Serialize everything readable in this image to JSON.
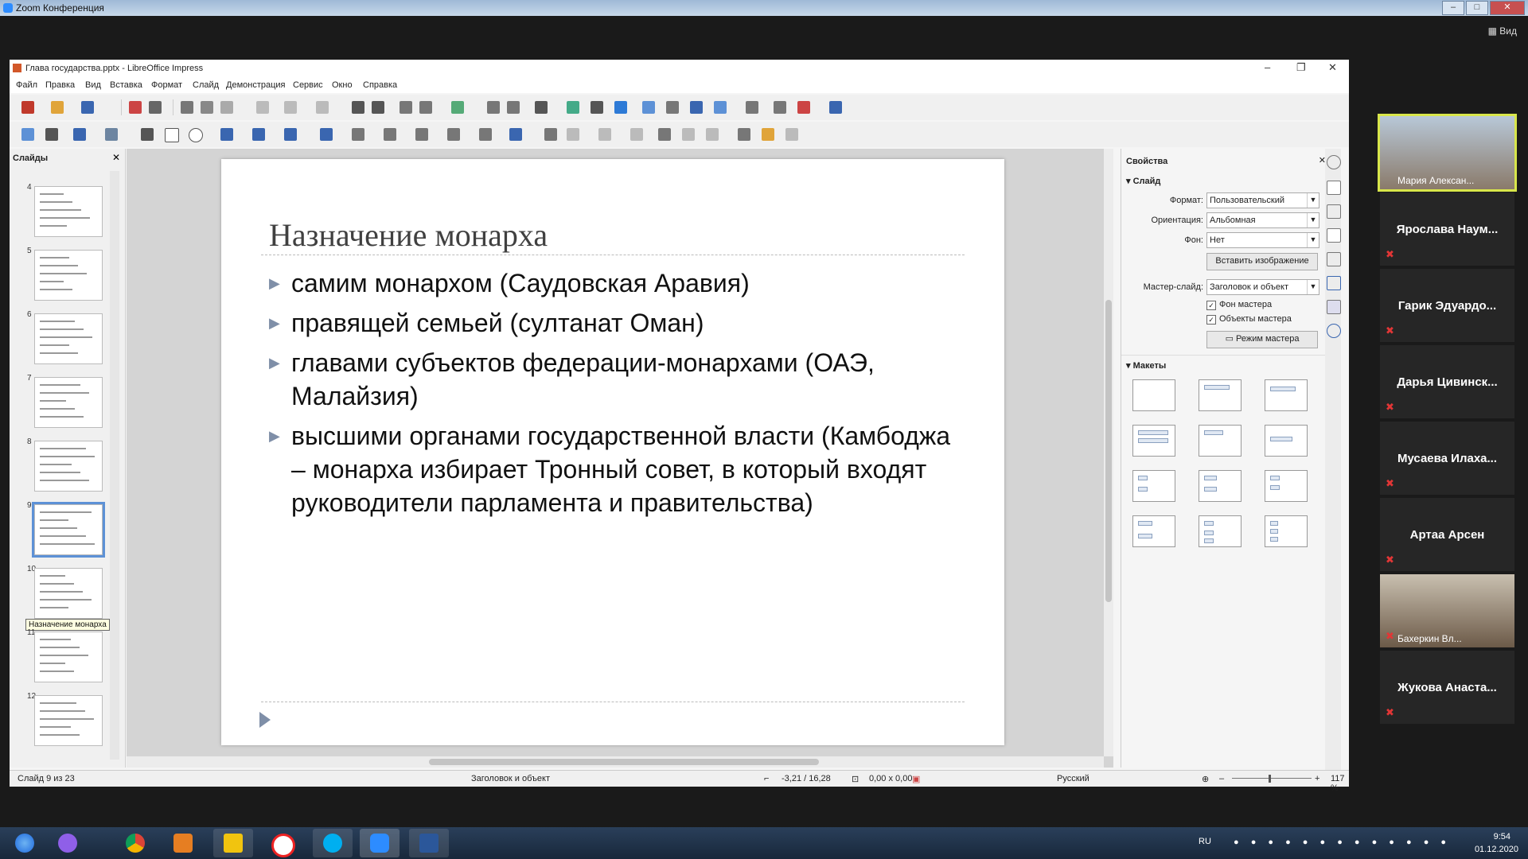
{
  "zoom": {
    "title": "Zoom Конференция",
    "view_label": "Вид"
  },
  "window": {
    "title": "Глава государства.pptx - LibreOffice Impress"
  },
  "menu": [
    "Файл",
    "Правка",
    "Вид",
    "Вставка",
    "Формат",
    "Слайд",
    "Демонстрация",
    "Сервис",
    "Окно",
    "Справка"
  ],
  "slides_panel": {
    "header": "Слайды",
    "numbers": [
      "4",
      "5",
      "6",
      "7",
      "8",
      "9",
      "10",
      "11",
      "12"
    ],
    "selected_index": 5,
    "tooltip": "Назначение монарха"
  },
  "slide": {
    "title": "Назначение монарха",
    "bullets": [
      "самим монархом (Саудовская Аравия)",
      "правящей семьей (султанат Оман)",
      "главами субъектов федерации-монархами (ОАЭ, Малайзия)",
      "высшими органами государственной власти (Камбоджа – монарха избирает Тронный совет, в который входят руководители парламента и правительства)"
    ]
  },
  "properties": {
    "header": "Свойства",
    "section_slide": "Слайд",
    "format_label": "Формат:",
    "format_value": "Пользовательский",
    "orientation_label": "Ориентация:",
    "orientation_value": "Альбомная",
    "background_label": "Фон:",
    "background_value": "Нет",
    "insert_image_button": "Вставить изображение",
    "master_label": "Мастер-слайд:",
    "master_value": "Заголовок и объект",
    "master_bg_checkbox": "Фон мастера",
    "master_objects_checkbox": "Объекты мастера",
    "master_mode_button": "Режим мастера",
    "section_layouts": "Макеты"
  },
  "status": {
    "slide_info": "Слайд 9 из 23",
    "layout": "Заголовок и объект",
    "position": "-3,21 / 16,28",
    "size": "0,00 x 0,00",
    "language": "Русский",
    "zoom": "117 %"
  },
  "participants": [
    {
      "name": "Мария Алексан...",
      "video": true,
      "active": true
    },
    {
      "name": "Ярослава  Наум...",
      "video": false
    },
    {
      "name": "Гарик  Эдуардо...",
      "video": false
    },
    {
      "name": "Дарья  Цивинск...",
      "video": false
    },
    {
      "name": "Мусаева  Илаха...",
      "video": false
    },
    {
      "name": "Артаа Арсен",
      "video": false
    },
    {
      "name": "Бахеркин Вл...",
      "video": true
    },
    {
      "name": "Жукова  Анаста...",
      "video": false
    }
  ],
  "taskbar": {
    "lang": "RU",
    "time": "9:54",
    "date": "01.12.2020"
  },
  "colors": {
    "selection": "#5d91d6",
    "mic_muted": "#e23636",
    "active_speaker": "#d8e64a"
  }
}
